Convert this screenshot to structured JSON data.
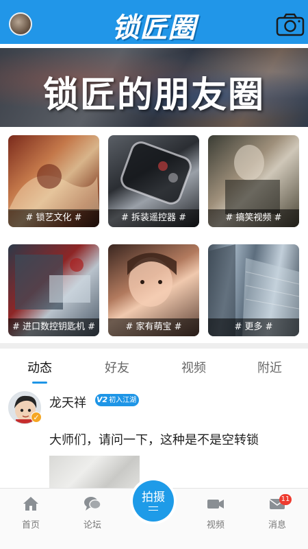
{
  "header": {
    "logo_text": "锁匠圈",
    "avatar_icon": "user-avatar",
    "camera_icon": "camera-icon"
  },
  "banner": {
    "title": "锁匠的朋友圈"
  },
  "categories": [
    {
      "label": "# 锁艺文化 #"
    },
    {
      "label": "# 拆装遥控器 #"
    },
    {
      "label": "# 搞笑视频 #"
    },
    {
      "label": "# 进口数控钥匙机 #"
    },
    {
      "label": "# 家有萌宝 #"
    },
    {
      "label": "# 更多 #"
    }
  ],
  "tabs": [
    {
      "label": "动态",
      "active": true
    },
    {
      "label": "好友",
      "active": false
    },
    {
      "label": "视频",
      "active": false
    },
    {
      "label": "附近",
      "active": false
    }
  ],
  "post": {
    "user_name": "龙天祥",
    "level_num": "V2",
    "level_label": "初入江湖",
    "text": "大师们，请问一下，这种是不是空转锁"
  },
  "bottom_nav": {
    "home": "首页",
    "forum": "论坛",
    "shoot": "拍摄",
    "video": "视频",
    "messages": "消息",
    "message_count": "11"
  },
  "colors": {
    "accent": "#2196e8",
    "badge_red": "#ee3b2f",
    "verify_orange": "#f5a623"
  }
}
